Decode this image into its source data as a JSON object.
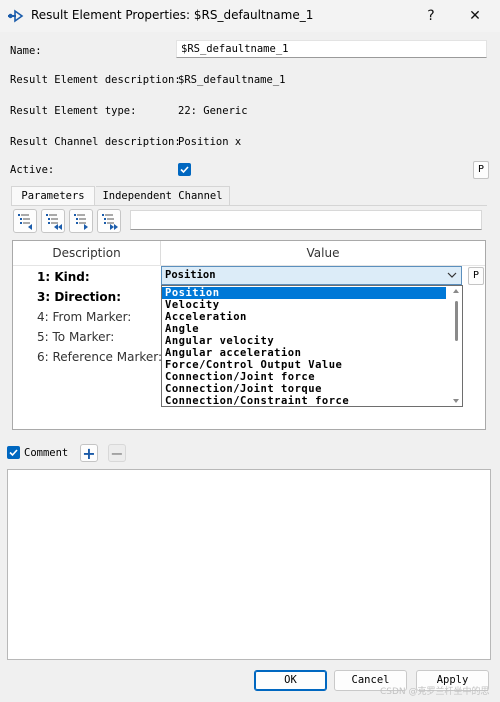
{
  "window": {
    "title": "Result Element Properties: $RS_defaultname_1",
    "help_glyph": "?",
    "close_glyph": "✕"
  },
  "form": {
    "name_label": "Name:",
    "name_value": "$RS_defaultname_1",
    "description_label": "Result Element description:",
    "description_value": "$RS_defaultname_1",
    "type_label": "Result Element type:",
    "type_value": "22: Generic",
    "channel_label": "Result Channel description:",
    "channel_value": "Position x",
    "active_label": "Active:",
    "active_checked": true,
    "p_button": "P"
  },
  "tabs": [
    {
      "label": "Parameters",
      "active": true
    },
    {
      "label": "Independent Channel",
      "active": false
    }
  ],
  "toolbar": {
    "icons": [
      "tree-collapse-left-icon",
      "tree-collapse-all-icon",
      "tree-expand-right-icon",
      "tree-expand-all-icon"
    ]
  },
  "parameter_table": {
    "headers": [
      "Description",
      "Value"
    ],
    "rows": [
      {
        "label": "1: Kind:",
        "bold": true
      },
      {
        "label": "3: Direction:",
        "bold": true
      },
      {
        "label": "4: From Marker:",
        "bold": false
      },
      {
        "label": "5: To Marker:",
        "bold": false
      },
      {
        "label": "6: Reference Marker:",
        "bold": false
      }
    ],
    "kind_value": "Position",
    "p_button": "P",
    "dropdown_options": [
      "Position",
      "Velocity",
      "Acceleration",
      "Angle",
      "Angular velocity",
      "Angular acceleration",
      "Force/Control Output Value",
      "Connection/Joint force",
      "Connection/Joint torque",
      "Connection/Constraint force"
    ],
    "dropdown_selected": "Position"
  },
  "comment": {
    "label": "Comment",
    "checked": true,
    "add_glyph": "+",
    "remove_glyph": "−"
  },
  "buttons": {
    "ok": "OK",
    "cancel": "Cancel",
    "apply": "Apply"
  },
  "watermark": "CSDN @克罗兰杆坐中的思",
  "colors": {
    "accent": "#0067c0",
    "selection": "#0078d7",
    "combo_bg": "#dcecf8"
  }
}
